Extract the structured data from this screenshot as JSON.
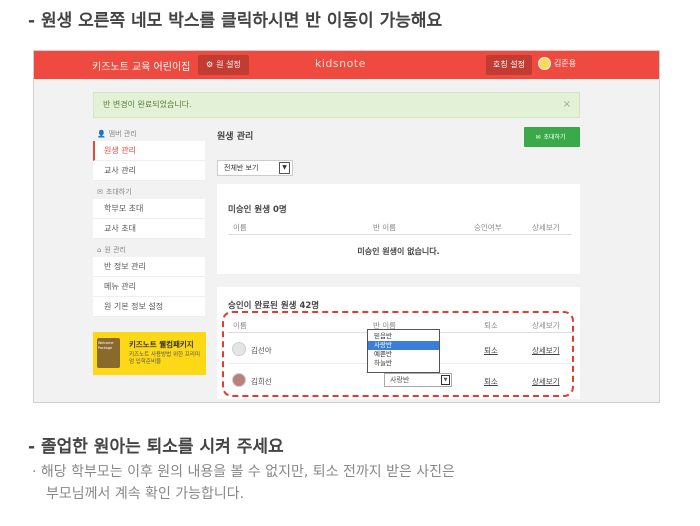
{
  "top_caption": "- 원생 오른쪽 네모 박스를 클릭하시면 반 이동이 가능해요",
  "header": {
    "brand": "키즈노트 교육 어린이집",
    "settings_label": "원 설정",
    "logo": "kidsnote",
    "teacher_settings": "호칭 설정",
    "user_name": "김준용"
  },
  "notice": {
    "message": "반 변경이 완료되었습니다.",
    "close": "×"
  },
  "sidebar": {
    "groups": [
      {
        "label": "멤버 관리",
        "items": [
          {
            "label": "원생 관리",
            "active": true
          },
          {
            "label": "교사 관리",
            "active": false
          }
        ]
      },
      {
        "label": "초대하기",
        "items": [
          {
            "label": "학부모 초대",
            "active": false
          },
          {
            "label": "교사 초대",
            "active": false
          }
        ]
      },
      {
        "label": "원 관리",
        "items": [
          {
            "label": "반 정보 관리",
            "active": false
          },
          {
            "label": "메뉴 관리",
            "active": false
          },
          {
            "label": "원 기본 정보 설정",
            "active": false
          }
        ]
      }
    ],
    "promo": {
      "title": "키즈노트 웰컴패키지",
      "subtitle": "키즈노트 사용방법 위한 프리미엄 입학준비물",
      "image_text": "Welcome Package"
    }
  },
  "main": {
    "title": "원생 관리",
    "register_button": "초대하기",
    "filter_value": "전체반 보기",
    "unapproved": {
      "title": "미승인 원생 0명",
      "columns": [
        "이름",
        "반 이름",
        "승인여부",
        "상세보기"
      ],
      "empty_message": "미승인 원생이 없습니다."
    },
    "approved": {
      "title": "승인이 완료된 원생 42명",
      "columns": [
        "이름",
        "반 이름",
        "퇴소",
        "상세보기"
      ],
      "rows": [
        {
          "name": "김선아",
          "class": "",
          "withdraw": "퇴소",
          "detail": "상세보기"
        },
        {
          "name": "김희선",
          "class": "사랑반",
          "withdraw": "퇴소",
          "detail": "상세보기"
        }
      ]
    },
    "dropdown_options": [
      {
        "label": "믿음반",
        "selected": false
      },
      {
        "label": "사랑반",
        "selected": true
      },
      {
        "label": "예쁜반",
        "selected": false
      },
      {
        "label": "하늘반",
        "selected": false
      }
    ]
  },
  "bottom": {
    "heading": "- 졸업한 원아는 퇴소를 시켜 주세요",
    "note_line1": "· 해당 학부모는 이후 원의 내용을 볼 수 없지만, 퇴소 전까지 받은 사진은",
    "note_line2": "부모님께서 계속 확인 가능합니다."
  },
  "colors": {
    "brand_red": "#ee4a3f",
    "accent_green": "#39a94a",
    "select_blue": "#3b7ddd",
    "notice_bg": "#e3f1d6",
    "promo_yellow": "#fdd816"
  }
}
